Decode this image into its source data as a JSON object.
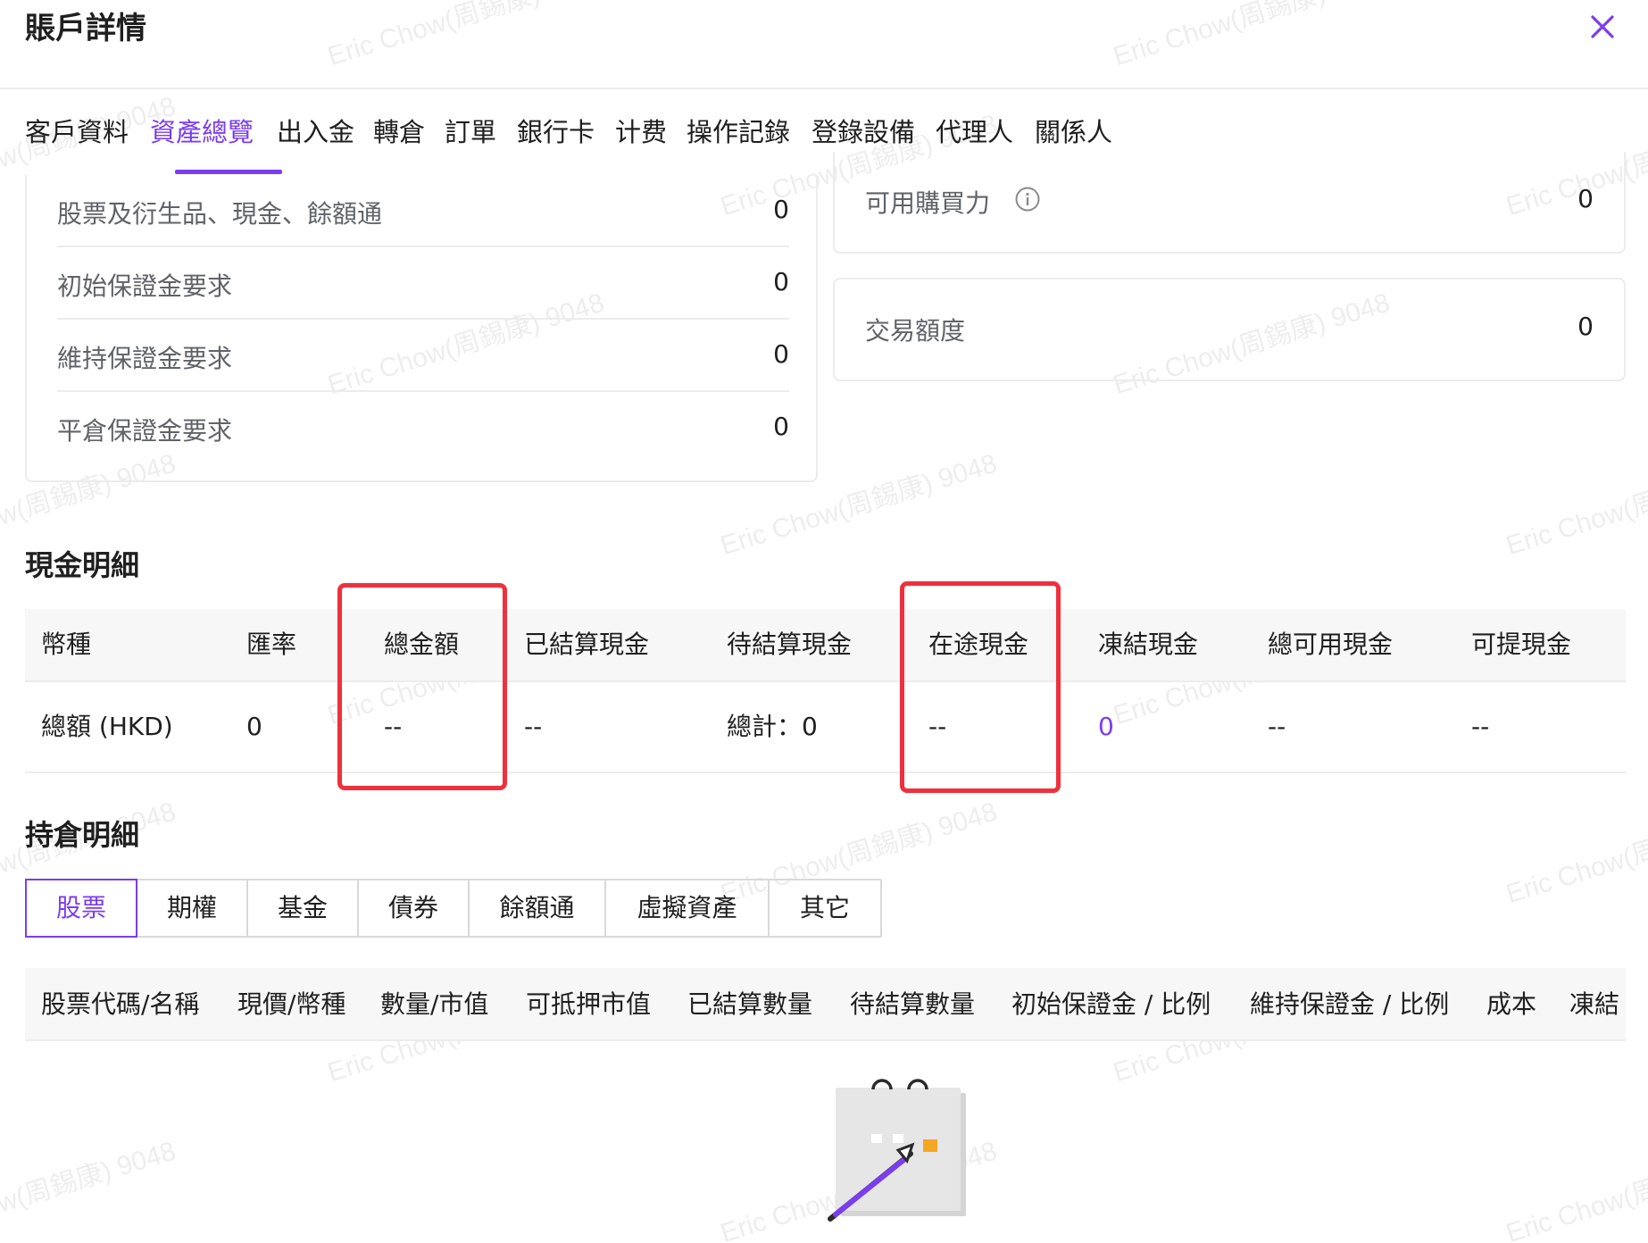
{
  "header": {
    "title": "賬戶詳情"
  },
  "tabs": [
    {
      "label": "客戶資料"
    },
    {
      "label": "資產總覽"
    },
    {
      "label": "出入金"
    },
    {
      "label": "轉倉"
    },
    {
      "label": "訂單"
    },
    {
      "label": "銀行卡"
    },
    {
      "label": "计费"
    },
    {
      "label": "操作記錄"
    },
    {
      "label": "登錄設備"
    },
    {
      "label": "代理人"
    },
    {
      "label": "關係人"
    }
  ],
  "active_tab": "資產總覽",
  "summary_left": [
    {
      "label": "股票及衍生品、現金、餘額通",
      "value": "0"
    },
    {
      "label": "初始保證金要求",
      "value": "0"
    },
    {
      "label": "維持保證金要求",
      "value": "0"
    },
    {
      "label": "平倉保證金要求",
      "value": "0"
    }
  ],
  "summary_right": [
    {
      "label": "可用購買力",
      "value": "0"
    },
    {
      "label": "交易額度",
      "value": "0"
    }
  ],
  "cash": {
    "title": "現金明細",
    "headers": [
      "幣種",
      "匯率",
      "總金額",
      "已結算現金",
      "待結算現金",
      "在途現金",
      "凍結現金",
      "總可用現金",
      "可提現金"
    ],
    "row": [
      "總額 (HKD)",
      "0",
      "--",
      "--",
      "總計：0",
      "--",
      "0",
      "--",
      "--"
    ]
  },
  "holdings": {
    "title": "持倉明細",
    "segments": [
      "股票",
      "期權",
      "基金",
      "債券",
      "餘額通",
      "虛擬資產",
      "其它"
    ],
    "active_segment": "股票",
    "headers": [
      "股票代碼/名稱",
      "現價/幣種",
      "數量/市值",
      "可抵押市值",
      "已結算數量",
      "待結算數量",
      "初始保證金 / 比例",
      "維持保證金 / 比例",
      "成本",
      "凍結"
    ]
  },
  "watermark": "Eric Chow(周錫康) 9048",
  "colors": {
    "accent": "#7a3df0",
    "highlight_box": "#f0303c",
    "border": "#ececec"
  }
}
